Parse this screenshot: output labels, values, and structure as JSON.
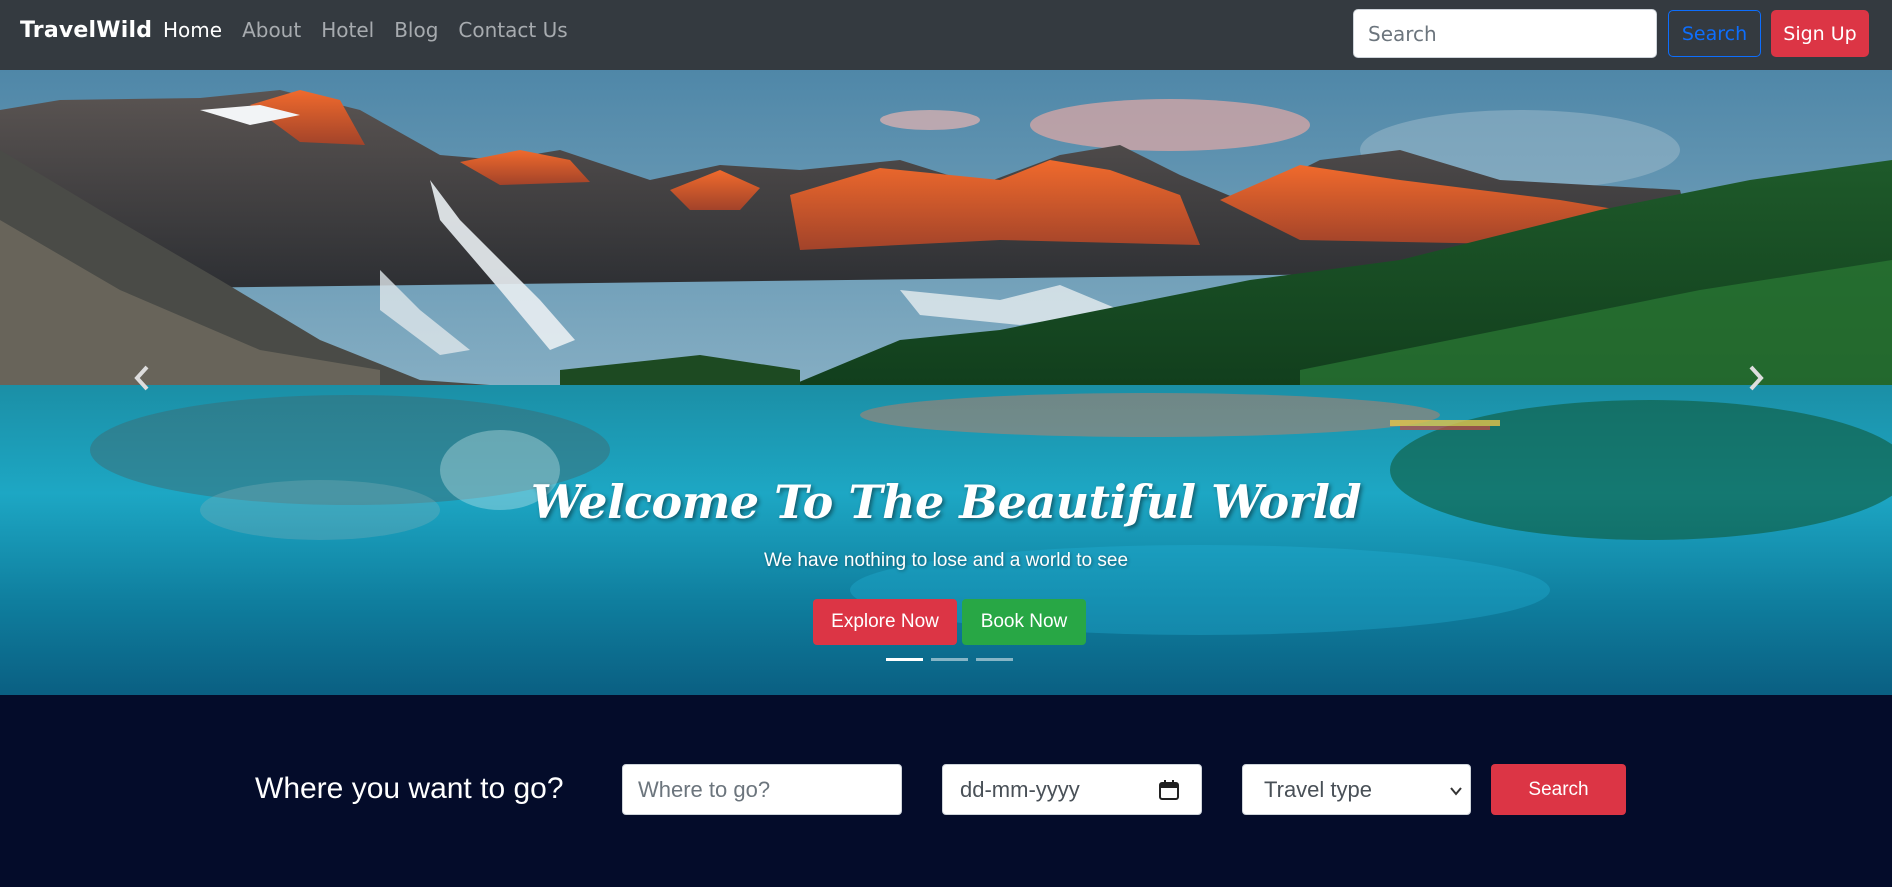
{
  "navbar": {
    "brand": "TravelWild",
    "links": [
      {
        "label": "Home",
        "active": true
      },
      {
        "label": "About",
        "active": false
      },
      {
        "label": "Hotel",
        "active": false
      },
      {
        "label": "Blog",
        "active": false
      },
      {
        "label": "Contact Us",
        "active": false
      }
    ],
    "search": {
      "placeholder": "Search"
    },
    "search_button": "Search",
    "signup_button": "Sign Up"
  },
  "hero": {
    "title": "Welcome To The Beautiful World",
    "subtitle": "We have nothing to lose and a world to see",
    "explore_button": "Explore Now",
    "book_button": "Book Now",
    "slides": 3,
    "active_slide": 1,
    "prev_icon": "chevron-left-icon",
    "next_icon": "chevron-right-icon"
  },
  "trip_search": {
    "label": "Where you want to go?",
    "destination_placeholder": "Where to go?",
    "date_placeholder": "dd-mm-yyyy",
    "travel_type": "Travel type",
    "search_button": "Search"
  },
  "colors": {
    "navbar": "#343a40",
    "danger": "#dc3545",
    "success": "#28a745",
    "primary": "#0d6efd",
    "strip_background": "#040c2a"
  }
}
